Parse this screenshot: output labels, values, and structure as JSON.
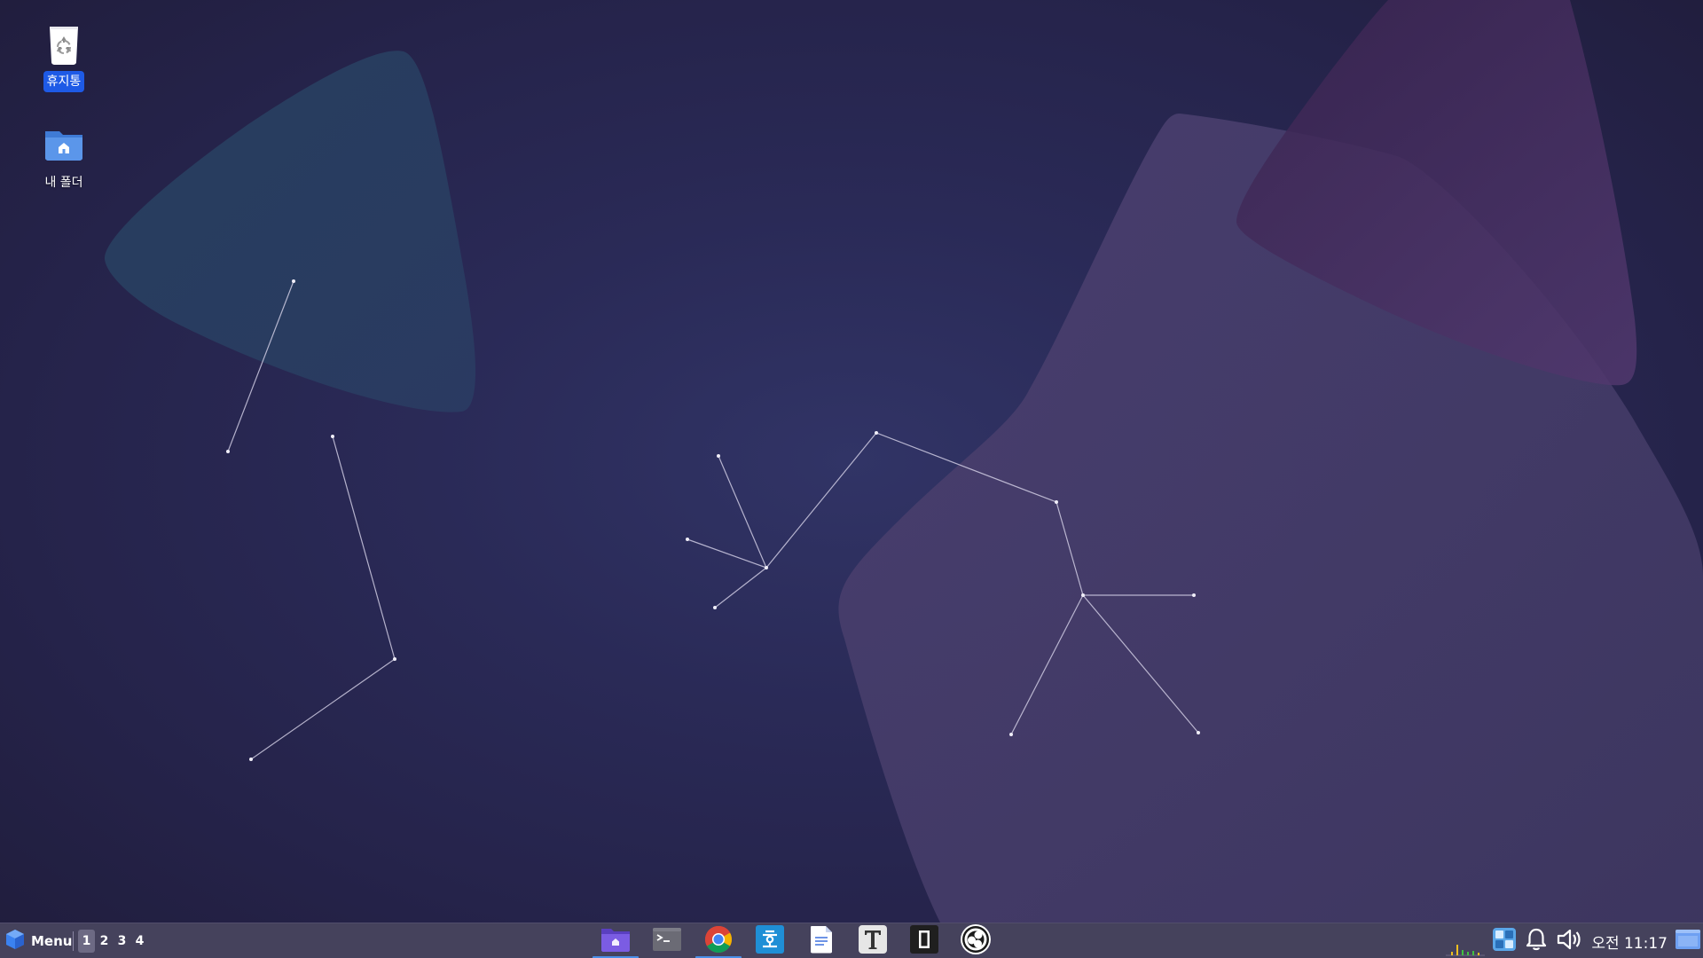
{
  "desktop": {
    "icons": [
      {
        "name": "trash",
        "label": "휴지통",
        "icon": "trash-icon",
        "selected": true
      },
      {
        "name": "home-folder",
        "label": "내 폴더",
        "icon": "home-folder-icon",
        "selected": false
      }
    ]
  },
  "taskbar": {
    "menu_label": "Menu",
    "workspaces": [
      "1",
      "2",
      "3",
      "4"
    ],
    "active_workspace": "1",
    "dock": [
      {
        "name": "file-manager",
        "icon": "folder-icon",
        "running": true
      },
      {
        "name": "terminal",
        "icon": "terminal-icon",
        "running": false
      },
      {
        "name": "chrome",
        "icon": "chrome-icon",
        "running": true
      },
      {
        "name": "hancom",
        "icon": "hancom-icon",
        "running": false
      },
      {
        "name": "text-editor",
        "icon": "document-icon",
        "running": false
      },
      {
        "name": "typora",
        "icon": "typora-icon",
        "running": false
      },
      {
        "name": "notes",
        "icon": "notes-icon",
        "running": false
      },
      {
        "name": "obs",
        "icon": "obs-icon",
        "running": false
      }
    ],
    "tray": {
      "clock": "오전 11:17"
    }
  },
  "colors": {
    "accent": "#1e5ae6",
    "taskbar_bg": "#45425c",
    "running_indicator": "#4a8fe8"
  }
}
